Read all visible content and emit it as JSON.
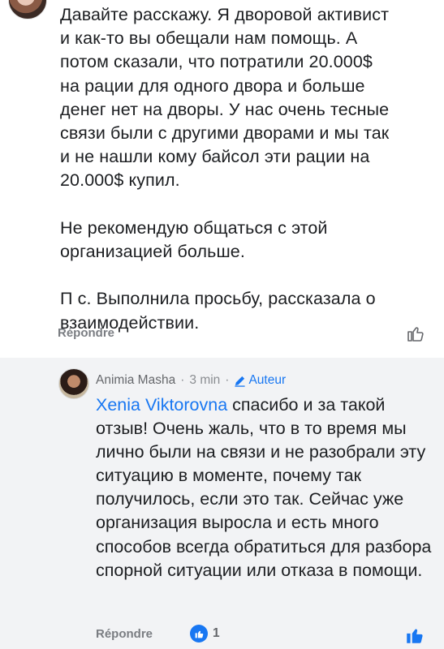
{
  "comment": {
    "text": "Давайте расскажу. Я дворовой активист\nи как-то вы обещали нам помощь. А\nпотом сказали, что потратили 20.000$\nна рации для одного двора и больше\nденег нет на дворы. У нас очень тесные\nсвязи были с другими дворами и мы так\nи не нашли кому байсол эти рации на\n20.000$ купил.\n\nНе рекомендую общаться с этой\nорганизацией больше.\n\nП с. Выполнила просьбу, рассказала о\nвзаимодействии.",
    "reply_label": "Répondre",
    "icons": {
      "avatar": "avatar",
      "like": "thumbs-up-outline-icon"
    }
  },
  "reply": {
    "author": "Animia Masha",
    "separator": "·",
    "time": "3 min",
    "badge": "Auteur",
    "mention": "Xenia Viktorovna",
    "text": " спасибо и за такой отзыв! Очень жаль, что в то время мы лично были на связи и не разобрали эту ситуацию в моменте, почему так получилось, если это так. Сейчас уже организация выросла и есть много способов всегда обратиться для разбора спорной ситуации или отказа в помощи.",
    "reply_label": "Répondre",
    "reaction_count": "1",
    "icons": {
      "reaction": "like-reaction-icon",
      "like": "thumbs-up-filled-icon",
      "badge": "pencil-icon"
    }
  },
  "colors": {
    "accent": "#1877f2",
    "muted": "#65676b",
    "reply_background": "#f2f3f5"
  }
}
